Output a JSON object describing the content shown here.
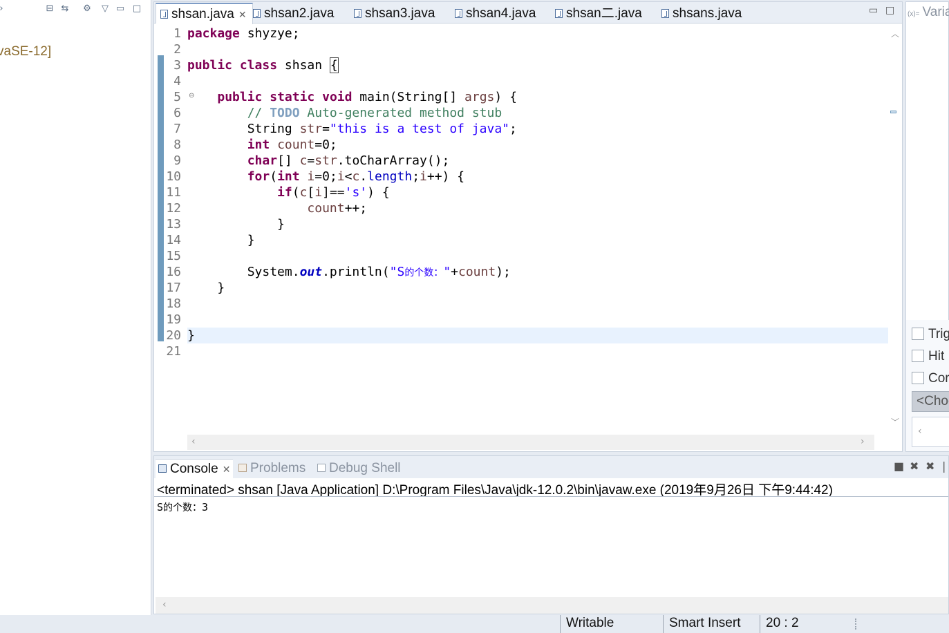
{
  "left_pane": {
    "tree_item": "vaSE-12]"
  },
  "editor": {
    "tabs": [
      {
        "label": "shsan.java",
        "active": true
      },
      {
        "label": "shsan2.java",
        "active": false
      },
      {
        "label": "shsan3.java",
        "active": false
      },
      {
        "label": "shsan4.java",
        "active": false
      },
      {
        "label": "shsan二.java",
        "active": false
      },
      {
        "label": "shsans.java",
        "active": false
      }
    ],
    "close_glyph": "✕",
    "line_numbers": [
      "1",
      "2",
      "3",
      "4",
      "5",
      "6",
      "7",
      "8",
      "9",
      "10",
      "11",
      "12",
      "13",
      "14",
      "15",
      "16",
      "17",
      "18",
      "19",
      "20",
      "21"
    ],
    "current_line": 20,
    "code": {
      "l1": [
        "package",
        " shyzye;"
      ],
      "l3": [
        "public",
        " ",
        "class",
        " shsan ",
        "{"
      ],
      "l5": [
        "    ",
        "public",
        " ",
        "static",
        " ",
        "void",
        " main(String[] ",
        "args",
        ") {"
      ],
      "l6": [
        "        // ",
        "TODO",
        " Auto-generated method stub"
      ],
      "l7": [
        "        String ",
        "str",
        "=",
        "\"this is a test of java\"",
        ";"
      ],
      "l8": [
        "        ",
        "int",
        " ",
        "count",
        "=0;"
      ],
      "l9": [
        "        ",
        "char",
        "[] ",
        "c",
        "=",
        "str",
        ".toCharArray();"
      ],
      "l10": [
        "        ",
        "for",
        "(",
        "int",
        " ",
        "i",
        "=0;",
        "i",
        "<",
        "c",
        ".",
        "length",
        ";",
        "i",
        "++) {"
      ],
      "l11": [
        "            ",
        "if",
        "(",
        "c",
        "[",
        "i",
        "]==",
        "'s'",
        ") {"
      ],
      "l12": [
        "                ",
        "count",
        "++;"
      ],
      "l13": "            }",
      "l14": "        }",
      "l16": [
        "        System.",
        "out",
        ".println(",
        "\"S",
        "的个数：",
        "\"",
        "+",
        "count",
        ");"
      ],
      "l17": "    }",
      "l20": "}"
    }
  },
  "right_pane": {
    "tab_prefix": "(x)=",
    "tab_label": "Varia",
    "checks": [
      "Trig",
      "Hit",
      "Cor"
    ],
    "choose": "<Choo"
  },
  "console": {
    "tabs": [
      {
        "label": "Console",
        "active": true
      },
      {
        "label": "Problems",
        "active": false
      },
      {
        "label": "Debug Shell",
        "active": false
      }
    ],
    "description": "<terminated> shsan [Java Application] D:\\Program Files\\Java\\jdk-12.0.2\\bin\\javaw.exe (2019年9月26日 下午9:44:42)",
    "output_prefix": "S",
    "output_cjk": "的个数：",
    "output_value": "3"
  },
  "statusbar": {
    "writable": "Writable",
    "insert_mode": "Smart Insert",
    "position": "20 : 2"
  },
  "colors": {
    "keyword": "#7f0055",
    "comment": "#3f7f5f",
    "string": "#2a00ff",
    "field": "#0000c0",
    "current_line": "#e8f2fe"
  }
}
